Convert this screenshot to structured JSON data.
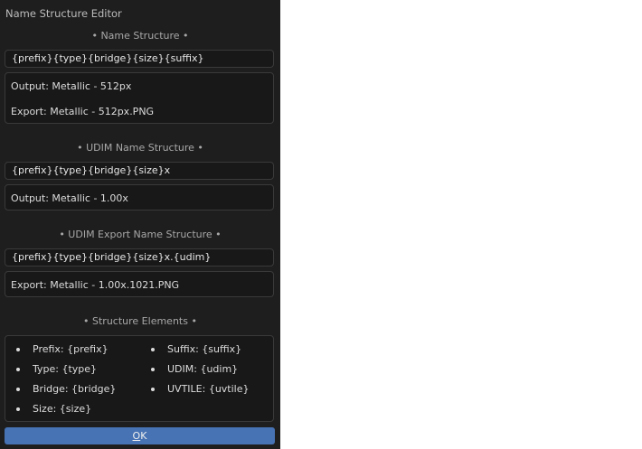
{
  "window_title": "Name Structure Editor",
  "name_structure": {
    "header": "• Name Structure •",
    "value": "{prefix}{type}{bridge}{size}{suffix}",
    "output": "Output: Metallic - 512px",
    "export": "Export: Metallic - 512px.PNG"
  },
  "udim_name_structure": {
    "header": "• UDIM Name Structure •",
    "value": "{prefix}{type}{bridge}{size}x",
    "output": "Output: Metallic - 1.00x"
  },
  "udim_export_structure": {
    "header": "• UDIM Export Name Structure •",
    "value": "{prefix}{type}{bridge}{size}x.{udim}",
    "export": "Export: Metallic - 1.00x.1021.PNG"
  },
  "structure_elements": {
    "header": "• Structure Elements •",
    "left": [
      "Prefix: {prefix}",
      "Type: {type}",
      "Bridge: {bridge}",
      "Size: {size}"
    ],
    "right": [
      "Suffix: {suffix}",
      "UDIM: {udim}",
      "UVTILE: {uvtile}"
    ]
  },
  "ok_button": {
    "mnemonic": "O",
    "rest": "K"
  },
  "colors": {
    "panel": "#1e1e1e",
    "accent": "#4772b3"
  }
}
